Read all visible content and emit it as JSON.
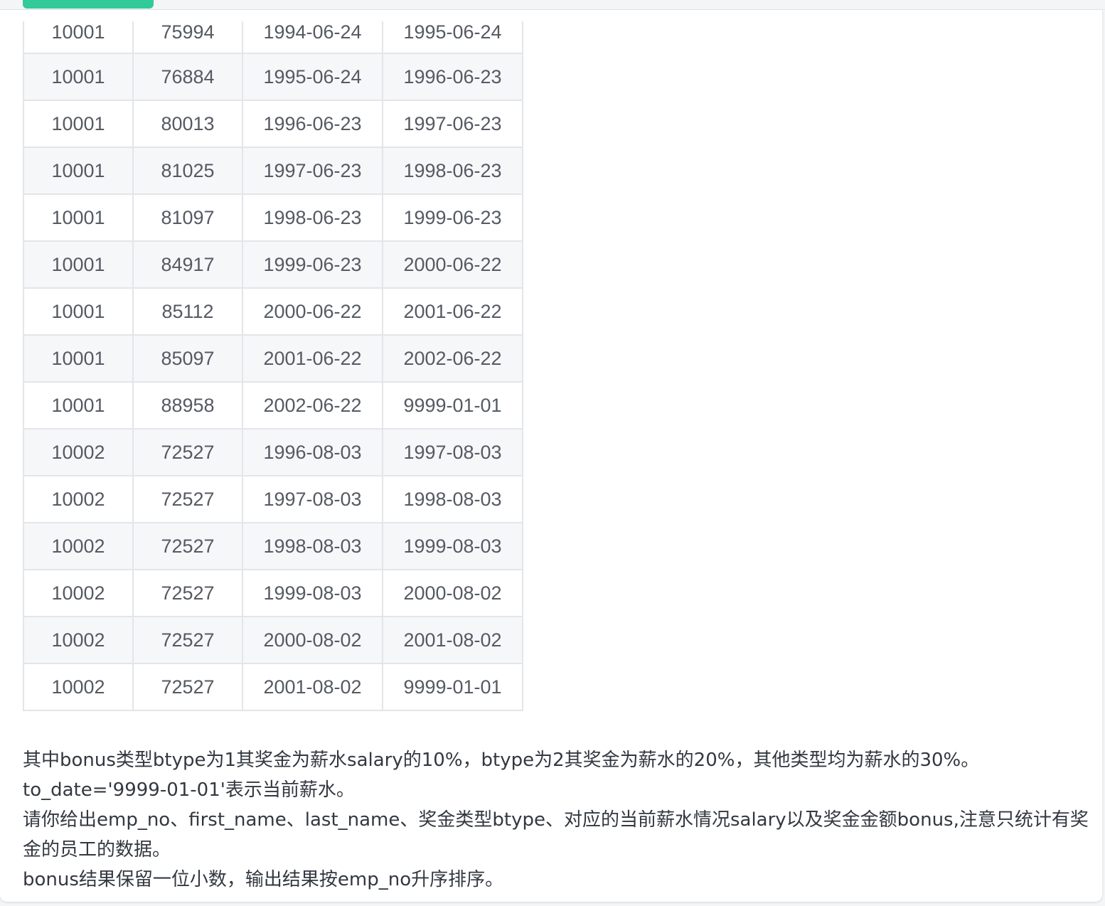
{
  "salaries_table": {
    "rows": [
      [
        "10001",
        "75994",
        "1994-06-24",
        "1995-06-24"
      ],
      [
        "10001",
        "76884",
        "1995-06-24",
        "1996-06-23"
      ],
      [
        "10001",
        "80013",
        "1996-06-23",
        "1997-06-23"
      ],
      [
        "10001",
        "81025",
        "1997-06-23",
        "1998-06-23"
      ],
      [
        "10001",
        "81097",
        "1998-06-23",
        "1999-06-23"
      ],
      [
        "10001",
        "84917",
        "1999-06-23",
        "2000-06-22"
      ],
      [
        "10001",
        "85112",
        "2000-06-22",
        "2001-06-22"
      ],
      [
        "10001",
        "85097",
        "2001-06-22",
        "2002-06-22"
      ],
      [
        "10001",
        "88958",
        "2002-06-22",
        "9999-01-01"
      ],
      [
        "10002",
        "72527",
        "1996-08-03",
        "1997-08-03"
      ],
      [
        "10002",
        "72527",
        "1997-08-03",
        "1998-08-03"
      ],
      [
        "10002",
        "72527",
        "1998-08-03",
        "1999-08-03"
      ],
      [
        "10002",
        "72527",
        "1999-08-03",
        "2000-08-02"
      ],
      [
        "10002",
        "72527",
        "2000-08-02",
        "2001-08-02"
      ],
      [
        "10002",
        "72527",
        "2001-08-02",
        "9999-01-01"
      ]
    ]
  },
  "description": {
    "line1": "其中bonus类型btype为1其奖金为薪水salary的10%，btype为2其奖金为薪水的20%，其他类型均为薪水的30%。",
    "line2": "to_date='9999-01-01'表示当前薪水。",
    "line3": "请你给出emp_no、first_name、last_name、奖金类型btype、对应的当前薪水情况salary以及奖金金额bonus,注意只统计有奖金的员工的数据。",
    "line4": "bonus结果保留一位小数，输出结果按emp_no升序排序。"
  },
  "colors": {
    "accent_green": "#32ca99",
    "text": "#555a62",
    "border": "#e3e5e8",
    "stripe": "#f6f7f9"
  }
}
